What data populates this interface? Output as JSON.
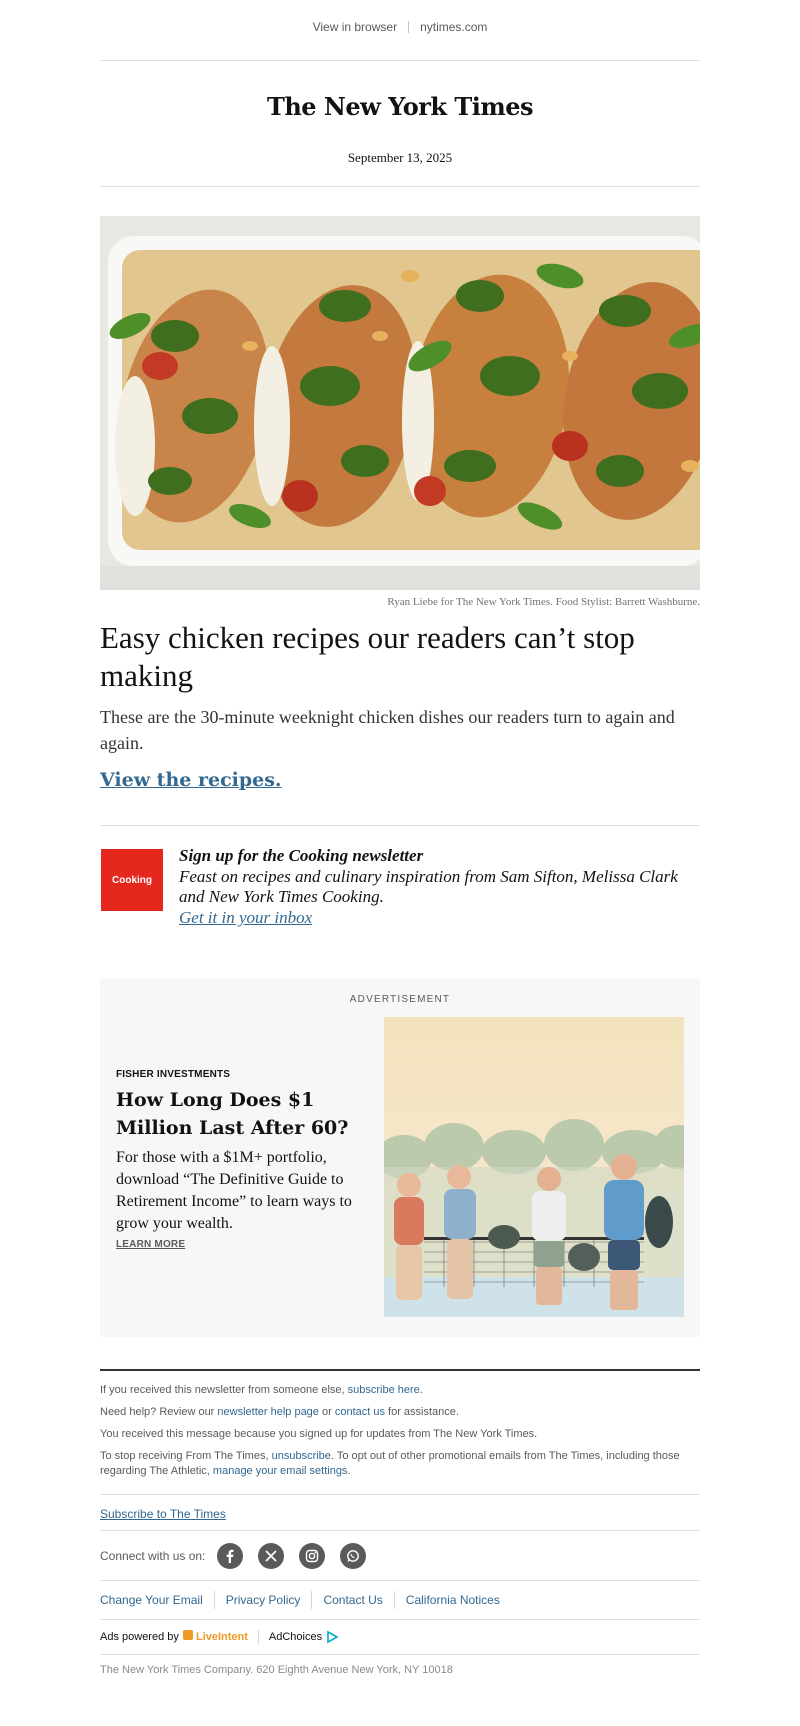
{
  "topbar": {
    "view_in_browser": "View in browser",
    "site": "nytimes.com"
  },
  "masthead": {
    "title": "The New York Times"
  },
  "date": "September 13, 2025",
  "hero": {
    "credit": "Ryan Liebe for The New York Times. Food Stylist: Barrett Washburne.",
    "headline": "Easy chicken recipes our readers can’t stop making",
    "dek": "These are the 30-minute weeknight chicken dishes our readers turn to again and again.",
    "cta": "View the recipes."
  },
  "promo": {
    "logo_text": "Cooking",
    "title": "Sign up for the Cooking newsletter",
    "description": "Feast on recipes and culinary inspiration from Sam Sifton, Melissa Clark and New York Times Cooking.",
    "link": "Get it in your inbox"
  },
  "ad": {
    "label": "ADVERTISEMENT",
    "brand": "FISHER INVESTMENTS",
    "title": "How Long Does $1 Million Last After 60?",
    "body": "For those with a $1M+ portfolio, download “The Definitive Guide to Retirement Income” to learn ways to grow your wealth.",
    "learn_more": "LEARN MORE"
  },
  "footer": {
    "line1_pre": "If you received this newsletter from someone else, ",
    "line1_link": "subscribe here",
    "line1_post": ".",
    "line2_pre": "Need help? Review our ",
    "line2_link1": "newsletter help page",
    "line2_mid": " or ",
    "line2_link2": "contact us",
    "line2_post": " for assistance.",
    "line3": "You received this message because you signed up for updates from The New York Times.",
    "line4_pre": "To stop receiving From The Times, ",
    "line4_link1": "unsubscribe",
    "line4_mid": ". To opt out of other promotional emails from The Times, including those regarding The Athletic, ",
    "line4_link2": "manage your email settings",
    "line4_post": ".",
    "subscribe": "Subscribe to The Times",
    "connect_label": "Connect with us on:",
    "social_icons": [
      "facebook-icon",
      "x-icon",
      "instagram-icon",
      "whatsapp-icon"
    ],
    "links": [
      "Change Your Email",
      "Privacy Policy",
      "Contact Us",
      "California Notices"
    ],
    "ads_powered_by": "Ads powered by",
    "liveintent": "LiveIntent",
    "adchoices": "AdChoices",
    "address": "The New York Times Company. 620 Eighth Avenue New York, NY 10018"
  },
  "colors": {
    "link": "#326891",
    "cooking_red": "#e5281e",
    "ad_background": "#f7f7f7"
  }
}
